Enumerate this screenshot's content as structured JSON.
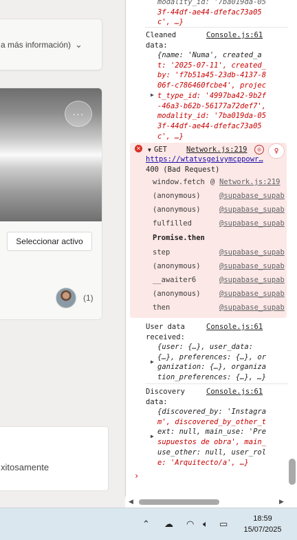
{
  "app": {
    "select_hint": "a más información)",
    "more_label": "···",
    "select_asset_label": "Seleccionar activo",
    "avatar_count": "(1)",
    "success_message": "xitosamente"
  },
  "console": {
    "top_partial": {
      "lines": [
        "modality_id: '7ba019da-05",
        "3f-44df-ae44-dfefac73a05",
        "c', …}"
      ]
    },
    "cleaned": {
      "label1": "Cleaned",
      "label2": "data:",
      "source": "Console.js:61",
      "lines": [
        "{name: 'Numa', created_a",
        "t: '2025-07-11', created_",
        "by: 'f7b51a45-23db-4137-8",
        "06f-c786460fcbe4', projec",
        "t_type_id: '4997ba42-9b2f",
        "-46a3-b62b-56177a72def7',",
        "modality_id: '7ba019da-05",
        "3f-44df-ae44-dfefac73a05",
        "c', …}"
      ]
    },
    "error": {
      "method": "GET",
      "source": "Network.js:219",
      "url": "https://wtatvsgeivymcppowr…",
      "status": "400 (Bad Request)",
      "frames": [
        {
          "fn": "window.fetch",
          "loc": "Network.js:219"
        },
        {
          "fn": "(anonymous)",
          "loc": "@supabase_supab"
        },
        {
          "fn": "(anonymous)",
          "loc": "@supabase_supab"
        },
        {
          "fn": "fulfilled",
          "loc": "@supabase_supab"
        },
        {
          "fn": "step",
          "loc": "@supabase_supab"
        },
        {
          "fn": "(anonymous)",
          "loc": "@supabase_supab"
        },
        {
          "fn": "__awaiter6",
          "loc": "@supabase_supab"
        },
        {
          "fn": "(anonymous)",
          "loc": "@supabase_supab"
        },
        {
          "fn": "then",
          "loc": "@supabase_supab"
        }
      ],
      "async_label": "Promise.then",
      "at": "@"
    },
    "user": {
      "label1": "User data",
      "label2": "received:",
      "source": "Console.js:61",
      "lines": [
        "{user: {…}, user_data:",
        "{…}, preferences: {…}, or",
        "ganization: {…}, organiza",
        "tion_preferences: {…}, …}"
      ]
    },
    "discovery": {
      "label1": "Discovery",
      "label2": "data:",
      "source": "Console.js:61",
      "lines": [
        "{discovered_by: 'Instagra",
        "m', discovered_by_other_t",
        "ext: null, main_use: 'Pre",
        "supuestos de obra', main_",
        "use_other: null, user_rol",
        "e: 'Arquitecto/a', …}"
      ]
    },
    "prompt": "›"
  },
  "taskbar": {
    "time": "18:59",
    "date": "15/07/2025",
    "icons": [
      "chevron-up-icon",
      "cloud-icon",
      "wifi-icon",
      "speaker-icon",
      "battery-icon"
    ]
  }
}
